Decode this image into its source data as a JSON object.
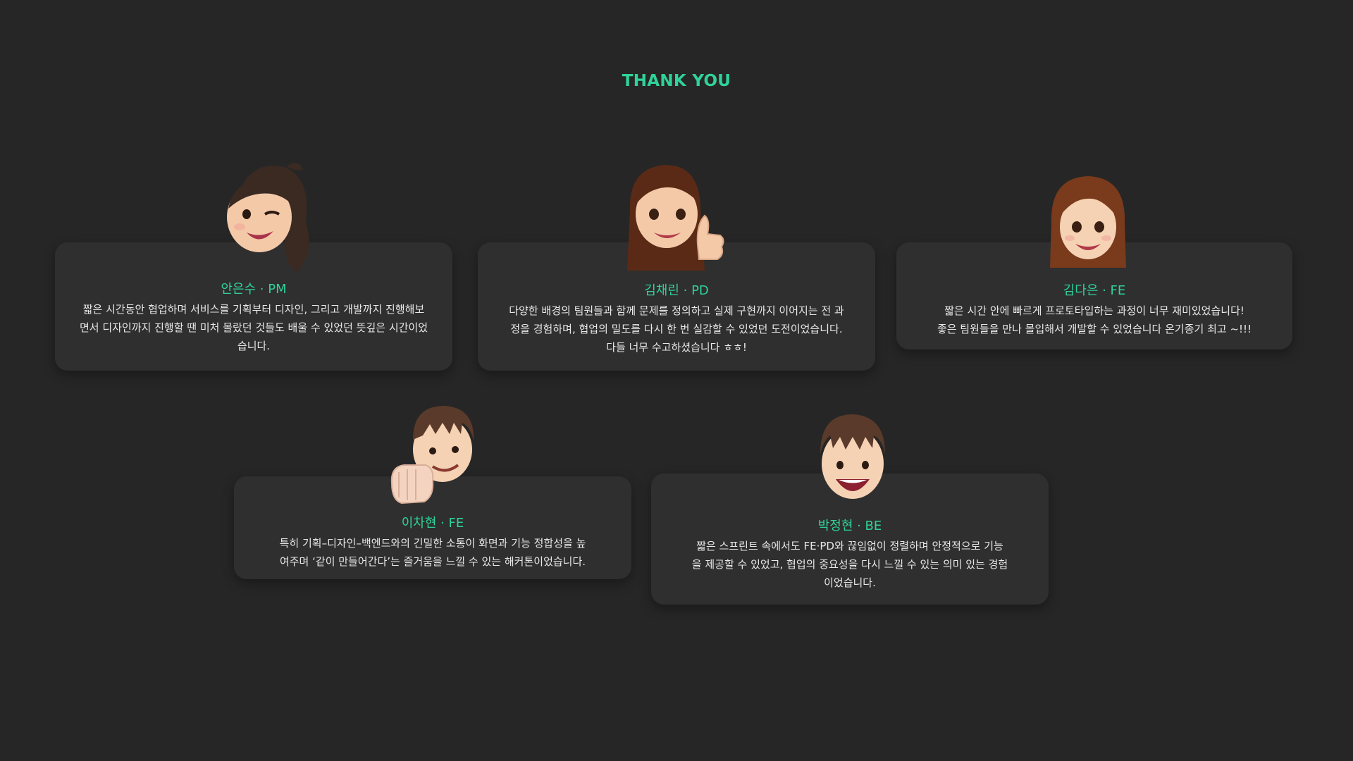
{
  "header": {
    "title": "THANK YOU"
  },
  "members": [
    {
      "name": "안은수 · PM",
      "message": "짧은 시간동안 협업하며 서비스를 기획부터 디자인, 그리고 개발까지 진행해보\n면서 디자인까지 진행할 땐 미처 몰랐던 것들도 배울 수 있었던 뜻깊은 시간이었\n습니다.",
      "avatar_icon": "memoji-winking-woman-icon"
    },
    {
      "name": "김채린 · PD",
      "message": "다양한 배경의 팀원들과 함께 문제를 정의하고 실제 구현까지 이어지는 전 과\n정을 경험하며, 협업의 밀도를 다시 한 번 실감할 수 있었던 도전이었습니다.\n다들 너무 수고하셨습니다 ㅎㅎ!",
      "avatar_icon": "memoji-thumbs-up-woman-icon"
    },
    {
      "name": "김다은 · FE",
      "message": "짧은 시간 안에 빠르게 프로토타입하는 과정이 너무 재미있었습니다!\n좋은 팀원들을 만나 몰입해서 개발할 수 있었습니다 온기종기 최고 ~!!!",
      "avatar_icon": "memoji-smiling-woman-icon"
    },
    {
      "name": "이차현 · FE",
      "message": "특히 기획–디자인–백엔드와의 긴밀한 소통이 화면과 기능 정합성을 높\n여주며 ‘같이 만들어간다’는 즐거움을 느낄 수 있는 해커톤이었습니다.",
      "avatar_icon": "memoji-fist-bump-man-icon"
    },
    {
      "name": "박정현 · BE",
      "message": "짧은 스프린트 속에서도 FE·PD와 끊임없이 정렬하며 안정적으로 기능\n을 제공할 수 있었고, 협업의 중요성을 다시 느낄 수 있는 의미 있는 경험\n이었습니다.",
      "avatar_icon": "memoji-laughing-man-icon"
    }
  ],
  "colors": {
    "background": "#262626",
    "card": "#2f2f2f",
    "accent": "#2fd39a",
    "text": "#e8e8e8"
  }
}
